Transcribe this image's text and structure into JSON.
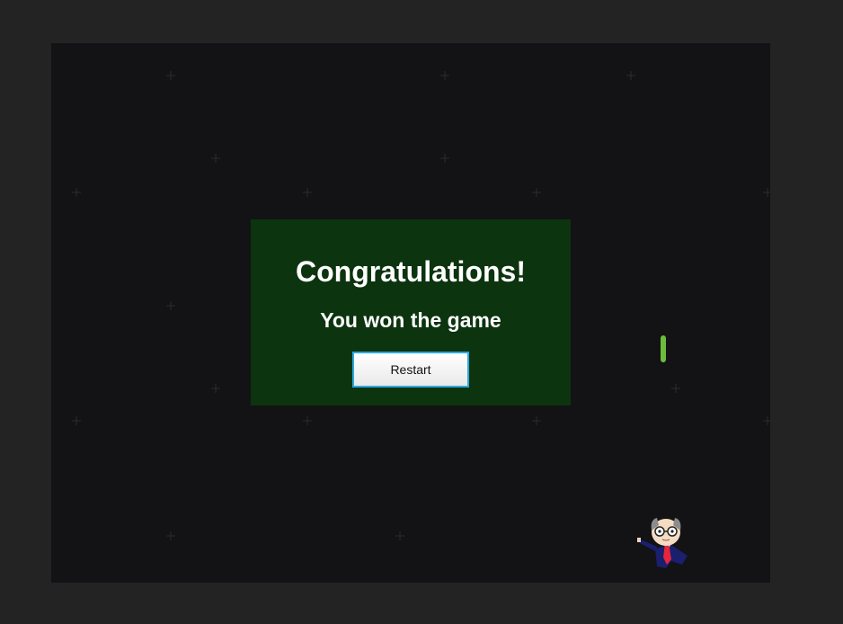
{
  "dialog": {
    "title": "Congratulations!",
    "message": "You won the game",
    "restart_label": "Restart"
  },
  "colors": {
    "page_background": "#232323",
    "canvas_background": "#131214",
    "dialog_background": "#0c340f",
    "button_border": "#2ea7e0",
    "paddle": "#6dbb3c"
  },
  "icons": {
    "character": "businessman-with-glasses-character",
    "paddle": "green-paddle",
    "stars": "star-field"
  }
}
